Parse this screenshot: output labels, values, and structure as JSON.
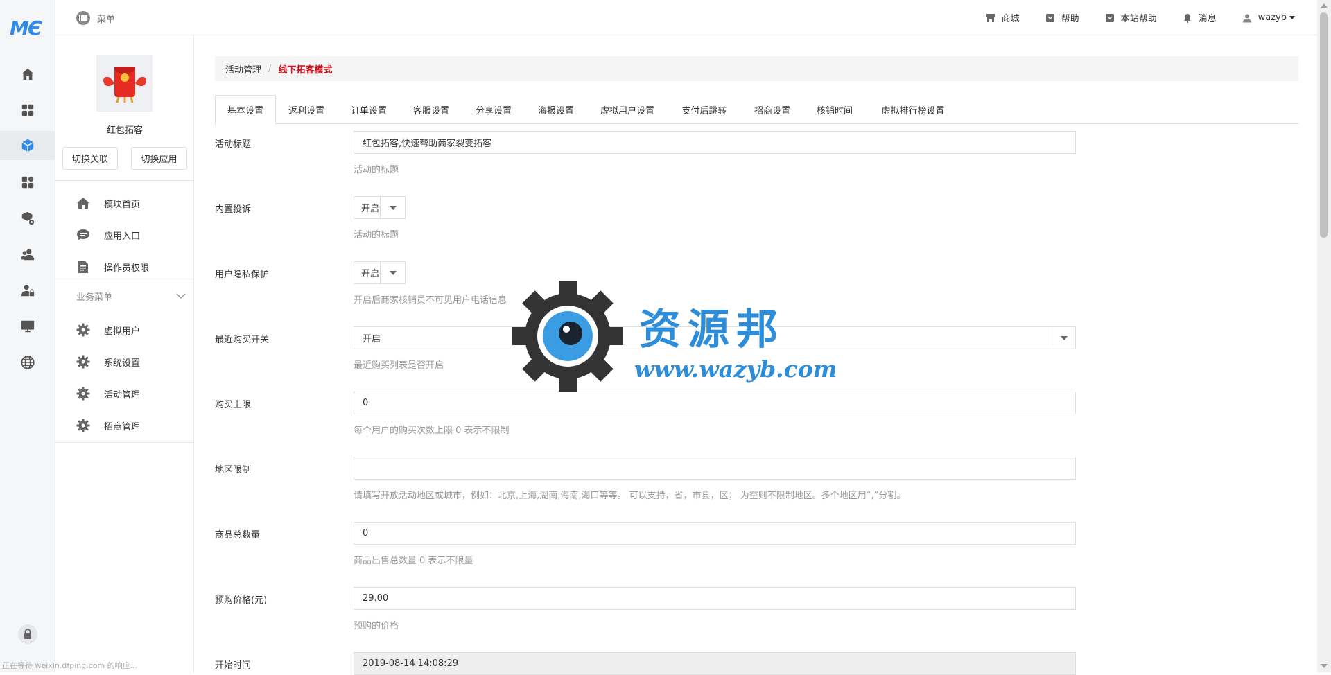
{
  "brand": {
    "logo_text": "MЄ",
    "accent": "#2f8ae8"
  },
  "topbar": {
    "menu_label": "菜单",
    "links": [
      {
        "icon": "store-icon",
        "label": "商城"
      },
      {
        "icon": "help-icon",
        "label": "帮助"
      },
      {
        "icon": "site-help-icon",
        "label": "本站帮助"
      },
      {
        "icon": "bell-icon",
        "label": "消息"
      },
      {
        "icon": "user-icon",
        "label": "wazyb"
      }
    ]
  },
  "sidebar": {
    "app_name": "红包拓客",
    "switch_link_label": "切换关联",
    "switch_app_label": "切换应用",
    "top_items": [
      {
        "icon": "home-icon",
        "label": "模块首页"
      },
      {
        "icon": "chat-icon",
        "label": "应用入口"
      },
      {
        "icon": "document-icon",
        "label": "操作员权限"
      }
    ],
    "biz_menu_title": "业务菜单",
    "biz_items": [
      {
        "icon": "gear-icon",
        "label": "虚拟用户"
      },
      {
        "icon": "gear-icon",
        "label": "系统设置"
      },
      {
        "icon": "gear-icon",
        "label": "活动管理"
      },
      {
        "icon": "gear-icon",
        "label": "招商管理"
      }
    ]
  },
  "breadcrumb": {
    "parent": "活动管理",
    "separator": "/",
    "current": "线下拓客模式",
    "current_color": "#d0101a"
  },
  "tabs": [
    "基本设置",
    "返利设置",
    "订单设置",
    "客服设置",
    "分享设置",
    "海报设置",
    "虚拟用户设置",
    "支付后跳转",
    "招商设置",
    "核销时间",
    "虚拟排行榜设置"
  ],
  "form": {
    "title": {
      "label": "活动标题",
      "value": "红包拓客,快速帮助商家裂变拓客",
      "help": "活动的标题"
    },
    "complaint": {
      "label": "内置投诉",
      "value": "开启",
      "help": "活动的标题"
    },
    "privacy": {
      "label": "用户隐私保护",
      "value": "开启",
      "help": "开启后商家核销员不可见用户电话信息"
    },
    "recent_buy": {
      "label": "最近购买开关",
      "value": "开启",
      "help": "最近购买列表是否开启"
    },
    "buy_limit": {
      "label": "购买上限",
      "value": "0",
      "help": "每个用户的购买次数上限 0 表示不限制"
    },
    "region": {
      "label": "地区限制",
      "value": "",
      "help": "请填写开放活动地区或城市，例如：北京,上海,湖南,海南,海口等等。 可以支持，省，市县，区； 为空则不限制地区。多个地区用“,”分割。"
    },
    "total_qty": {
      "label": "商品总数量",
      "value": "0",
      "help": "商品出售总数量 0 表示不限量"
    },
    "presale_price": {
      "label": "预购价格(元)",
      "value": "29.00",
      "help": "预购的价格"
    },
    "start_time": {
      "label": "开始时间",
      "value": "2019-08-14 14:08:29"
    }
  },
  "watermark": {
    "title": "资源邦",
    "url": "www.wazyb.com"
  },
  "status_bar": "正在等待 weixin.dfping.com 的响应..."
}
